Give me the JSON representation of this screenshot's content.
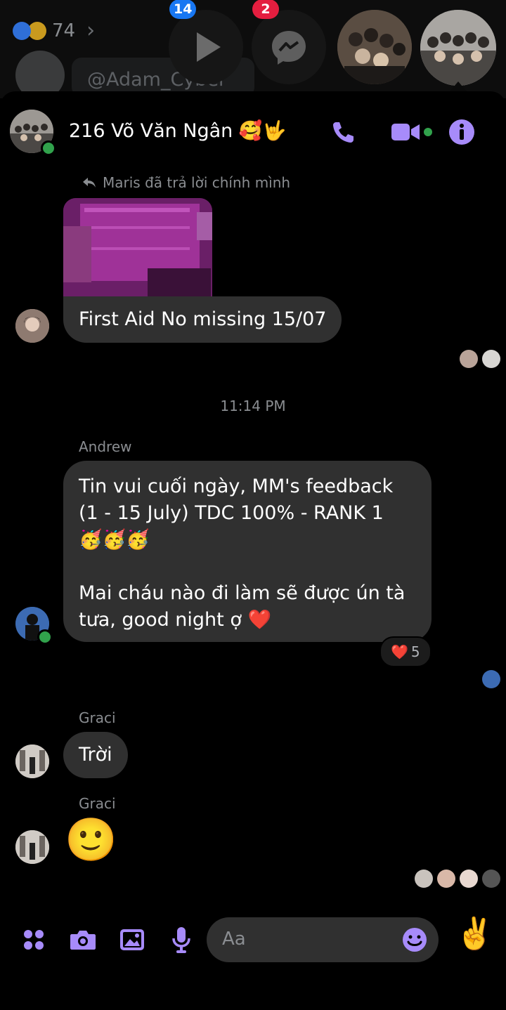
{
  "background": {
    "reaction_count": "74",
    "handle": "@Adam_Cyber"
  },
  "chat_heads": {
    "video_badge": "14",
    "messenger_badge": "2"
  },
  "header": {
    "title": "216 Võ Văn Ngân 🥰🤟"
  },
  "messages": {
    "reply_note": "Maris đã trả lời chính mình",
    "first_aid": "First Aid No missing 15/07",
    "timestamp": "11:14 PM",
    "andrew_name": "Andrew",
    "andrew_line1": "Tin vui cuối ngày, MM's feedback",
    "andrew_line2": "(1 - 15 July) TDC 100% - RANK 1",
    "andrew_line3": "🥳🥳🥳",
    "andrew_line4": "Mai cháu nào đi làm sẽ được ún tà",
    "andrew_line5": "tưa, good night ợ ❤️",
    "andrew_reaction_emoji": "❤️",
    "andrew_reaction_count": "5",
    "graci_name_1": "Graci",
    "graci_text": "Trời",
    "graci_name_2": "Graci",
    "graci_emoji": "🙂"
  },
  "composer": {
    "placeholder": "Aa",
    "quick_emoji": "✌️"
  },
  "colors": {
    "accent": "#a78bfa",
    "bubble": "#303030",
    "online": "#31a24c"
  }
}
